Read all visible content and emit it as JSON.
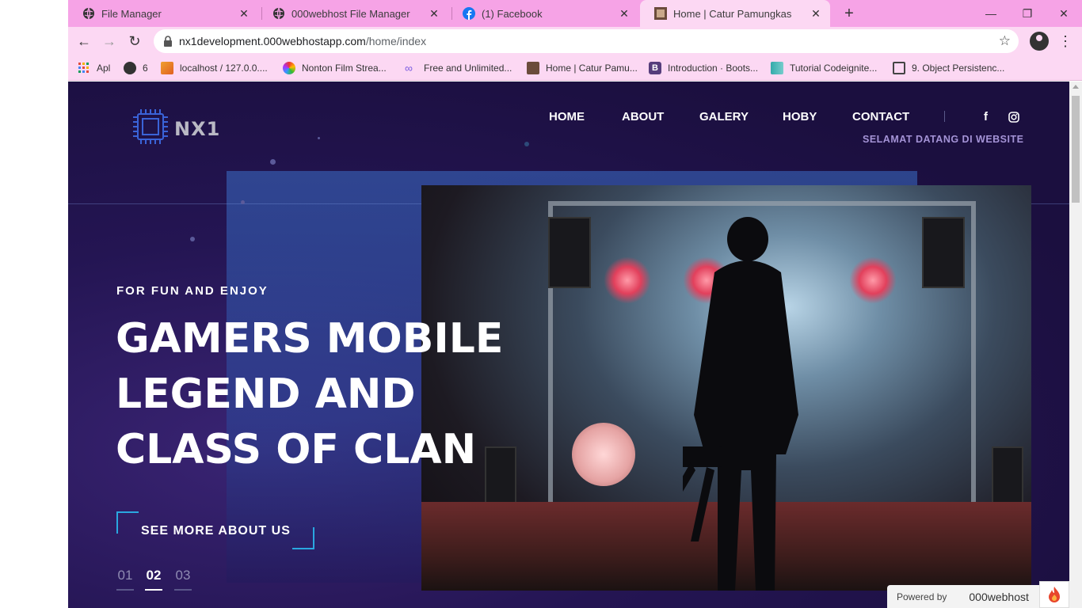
{
  "browser": {
    "tabs": [
      {
        "title": "File Manager",
        "icon": "globe-icon",
        "active": false
      },
      {
        "title": "000webhost File Manager",
        "icon": "globe-icon",
        "active": false
      },
      {
        "title": "(1) Facebook",
        "icon": "facebook-icon",
        "active": false
      },
      {
        "title": "Home | Catur Pamungkas",
        "icon": "site-thumbnail-icon",
        "active": true
      }
    ],
    "url_host": "nx1development.000webhostapp.com",
    "url_path": "/home/index",
    "bookmarks": [
      {
        "label": "Apl",
        "icon": "apps-grid-icon"
      },
      {
        "label": "6",
        "icon": "globe-icon"
      },
      {
        "label": "localhost / 127.0.0....",
        "icon": "phpmyadmin-icon"
      },
      {
        "label": "Nonton Film Strea...",
        "icon": "flower-icon"
      },
      {
        "label": "Free and Unlimited...",
        "icon": "infinity-icon"
      },
      {
        "label": "Home | Catur Pamu...",
        "icon": "site-thumbnail-icon"
      },
      {
        "label": "Introduction · Boots...",
        "icon": "bootstrap-icon"
      },
      {
        "label": "Tutorial Codeignite...",
        "icon": "book-icon"
      },
      {
        "label": "9. Object Persistenc...",
        "icon": "book-open-icon"
      }
    ]
  },
  "site": {
    "logo_text": "NX1",
    "nav": [
      "HOME",
      "ABOUT",
      "GALERY",
      "HOBY",
      "CONTACT"
    ],
    "social": {
      "facebook": "f",
      "instagram": "◎"
    },
    "welcome": "SELAMAT DATANG DI WEBSITE",
    "eyebrow": "FOR FUN AND ENJOY",
    "headline": [
      "GAMERS MOBILE",
      "LEGEND AND",
      "CLASS OF CLAN"
    ],
    "cta": "SEE MORE ABOUT US",
    "pager": [
      "01",
      "02",
      "03"
    ],
    "pager_active": "02",
    "powered_label": "Powered by",
    "powered_brand": "000webhost"
  },
  "colors": {
    "tabbar": "#f6a3e6",
    "toolbar": "#fcd8f3",
    "page_bg": "#241553",
    "accent": "#2aa7e0",
    "welcome": "#a493d6"
  }
}
